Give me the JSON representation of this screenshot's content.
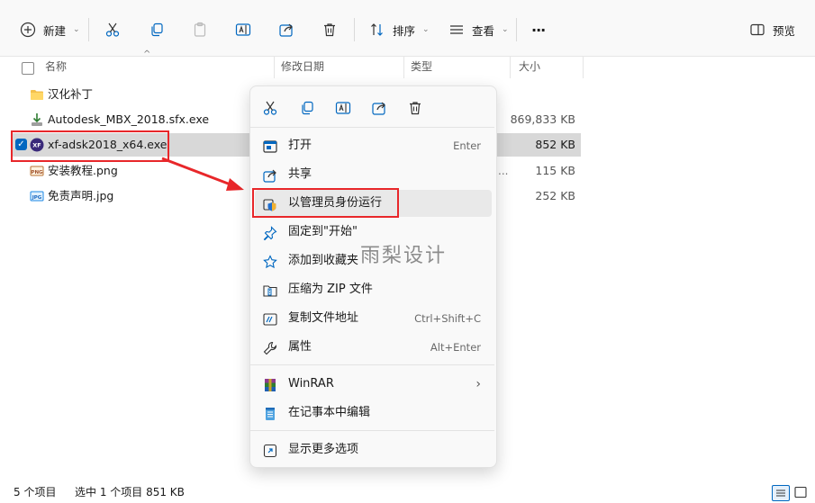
{
  "toolbar": {
    "new_label": "新建",
    "sort_label": "排序",
    "view_label": "查看",
    "more_label": "···",
    "preview_label": "预览"
  },
  "columns": {
    "name": "名称",
    "modified": "修改日期",
    "type": "类型",
    "size": "大小"
  },
  "files": [
    {
      "name": "汉化补丁",
      "size": "",
      "icon": "folder-icon"
    },
    {
      "name": "Autodesk_MBX_2018.sfx.exe",
      "size": "869,833 KB",
      "icon": "installer-icon"
    },
    {
      "name": "xf-adsk2018_x64.exe",
      "size": "852 KB",
      "icon": "keygen-app-icon"
    },
    {
      "name": "安装教程.png",
      "size": "115 KB",
      "icon": "png-file-icon",
      "type_fragment": "..."
    },
    {
      "name": "免责声明.jpg",
      "size": "252 KB",
      "icon": "jpg-file-icon"
    }
  ],
  "context_menu": {
    "items": [
      {
        "label": "打开",
        "shortcut": "Enter",
        "icon": "open-app-icon"
      },
      {
        "label": "共享",
        "shortcut": "",
        "icon": "share-icon"
      },
      {
        "label": "以管理员身份运行",
        "shortcut": "",
        "icon": "shield-icon"
      },
      {
        "label": "固定到\"开始\"",
        "shortcut": "",
        "icon": "pin-icon"
      },
      {
        "label": "添加到收藏夹",
        "shortcut": "",
        "icon": "star-icon"
      },
      {
        "label": "压缩为 ZIP 文件",
        "shortcut": "",
        "icon": "zip-icon"
      },
      {
        "label": "复制文件地址",
        "shortcut": "Ctrl+Shift+C",
        "icon": "copy-path-icon"
      },
      {
        "label": "属性",
        "shortcut": "Alt+Enter",
        "icon": "wrench-icon"
      },
      {
        "label": "WinRAR",
        "shortcut": "",
        "icon": "winrar-icon"
      },
      {
        "label": "在记事本中编辑",
        "shortcut": "",
        "icon": "notepad-icon"
      },
      {
        "label": "显示更多选项",
        "shortcut": "",
        "icon": "more-options-icon"
      }
    ]
  },
  "status": {
    "count": "5 个项目",
    "selected": "选中 1 个项目  851 KB"
  },
  "watermark": "雨梨设计",
  "colors": {
    "highlight_red": "#e8272a",
    "accent_blue": "#0067c0",
    "selection_gray": "#d8d8d8"
  }
}
